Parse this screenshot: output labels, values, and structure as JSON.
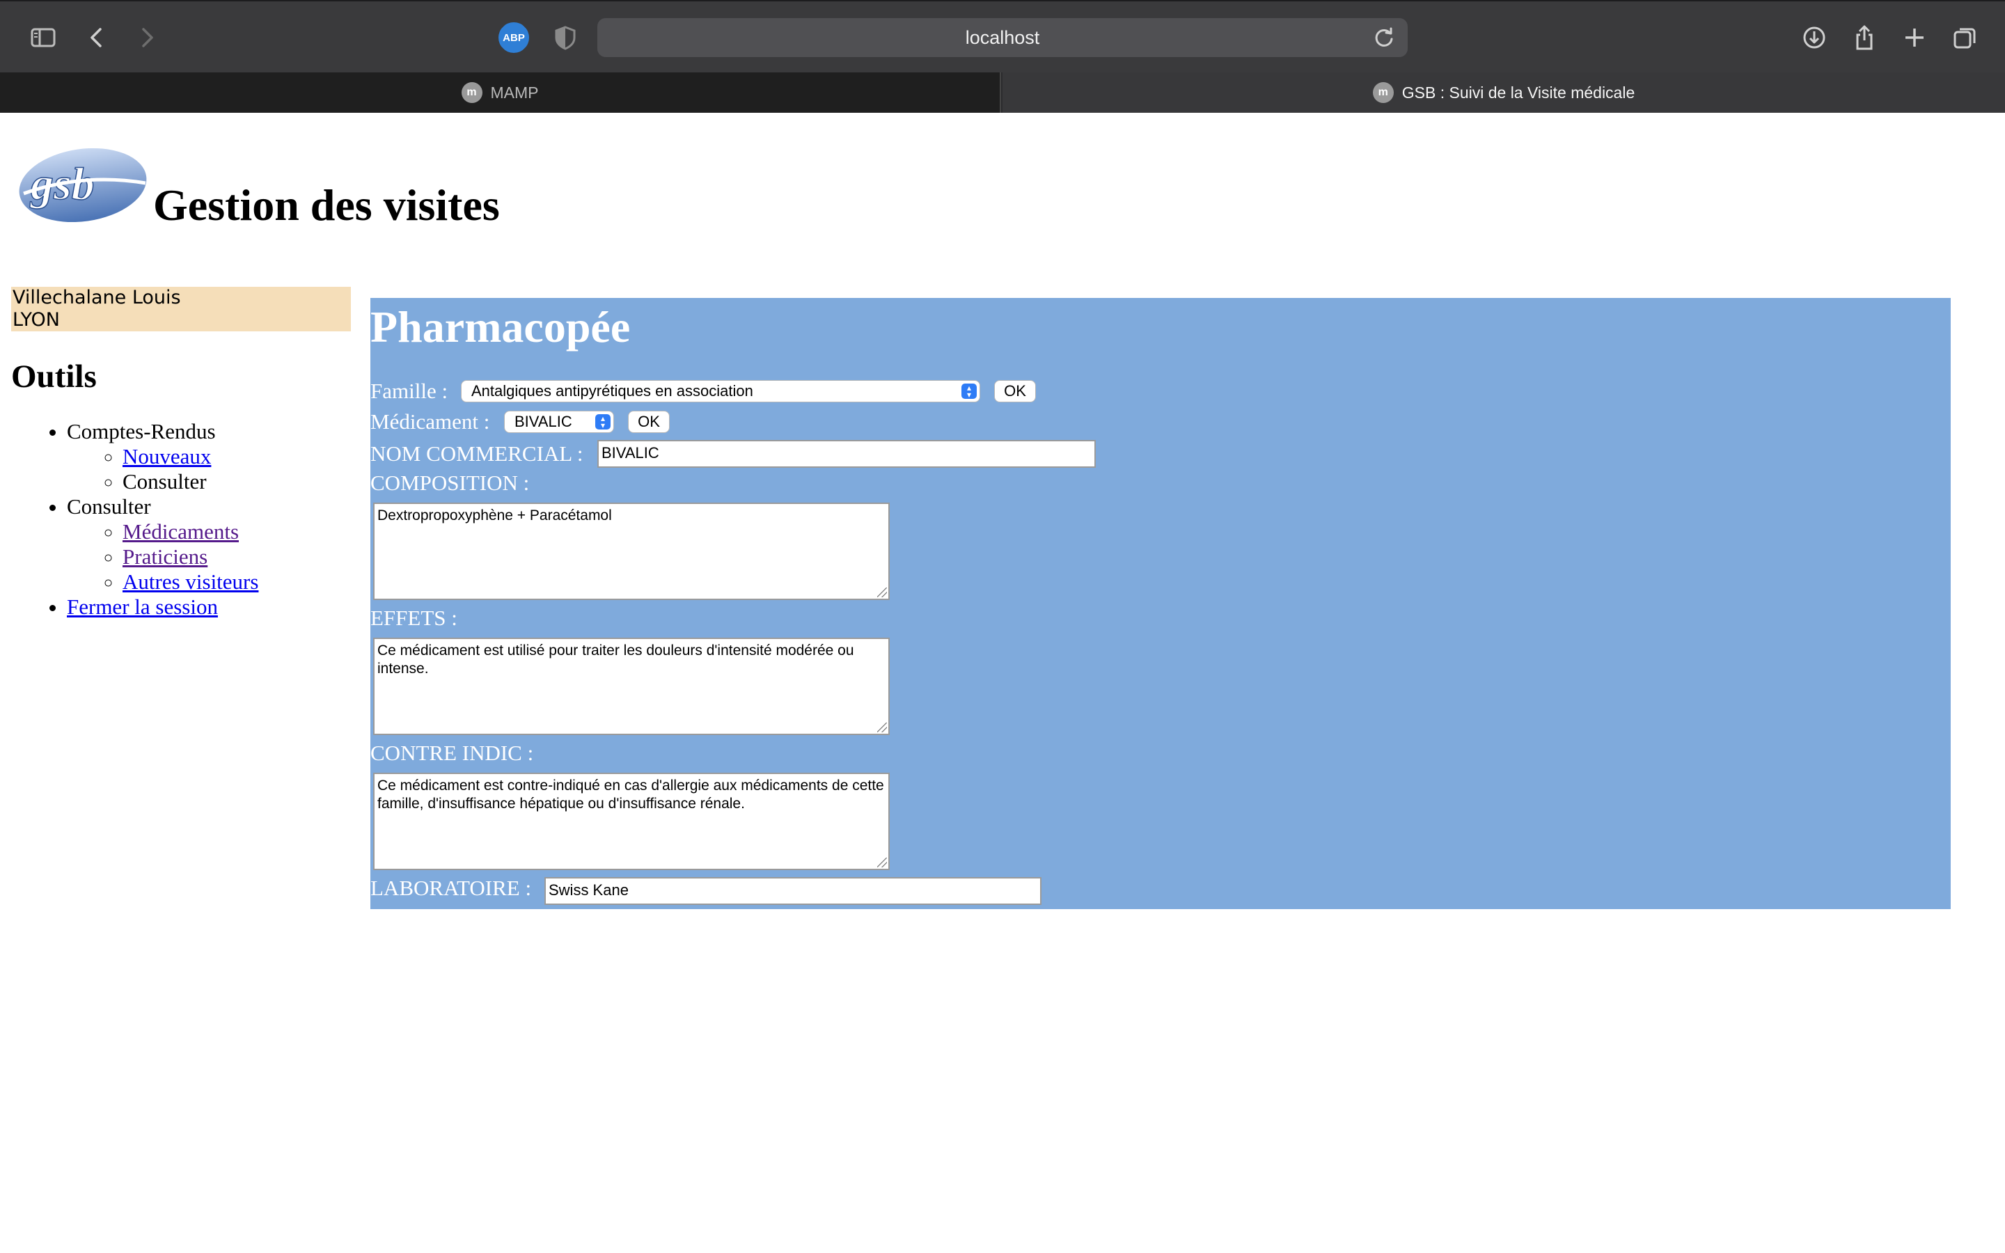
{
  "browser": {
    "url": "localhost",
    "tabs": [
      {
        "label": "MAMP",
        "active": false
      },
      {
        "label": "GSB : Suivi de la Visite médicale",
        "active": true
      }
    ],
    "adblock_label": "ABP"
  },
  "header": {
    "logo_text": "gsb",
    "title": "Gestion des visites"
  },
  "user": {
    "name": "Villechalane Louis",
    "region": "LYON"
  },
  "sidebar": {
    "title": "Outils",
    "menu": {
      "comptes_rendus": "Comptes-Rendus",
      "nouveaux": "Nouveaux",
      "consulter_cr": "Consulter",
      "consulter": "Consulter",
      "medicaments": "Médicaments",
      "praticiens": "Praticiens",
      "autres_visiteurs": "Autres visiteurs",
      "fermer_session": "Fermer la session"
    }
  },
  "main": {
    "title": "Pharmacopée",
    "famille_label": "Famille :",
    "famille_value": "Antalgiques antipyrétiques en association",
    "famille_ok": "OK",
    "medicament_label": "Médicament :",
    "medicament_value": "BIVALIC",
    "medicament_ok": "OK",
    "nom_label": "NOM COMMERCIAL :",
    "nom_value": "BIVALIC",
    "composition_label": "COMPOSITION :",
    "composition_value": "Dextropropoxyphène + Paracétamol",
    "effets_label": "EFFETS :",
    "effets_value": "Ce médicament est utilisé pour traiter les douleurs d'intensité modérée ou intense.",
    "contre_label": "CONTRE INDIC :",
    "contre_value": "Ce médicament est contre-indiqué en cas d'allergie aux médicaments de cette famille, d'insuffisance hépatique ou d'insuffisance rénale.",
    "labo_label": "LABORATOIRE :",
    "labo_value": "Swiss Kane"
  },
  "colors": {
    "main_bg": "#7faadc",
    "user_box_bg": "#f5deb9",
    "chrome_bg": "#3a3a3c"
  }
}
